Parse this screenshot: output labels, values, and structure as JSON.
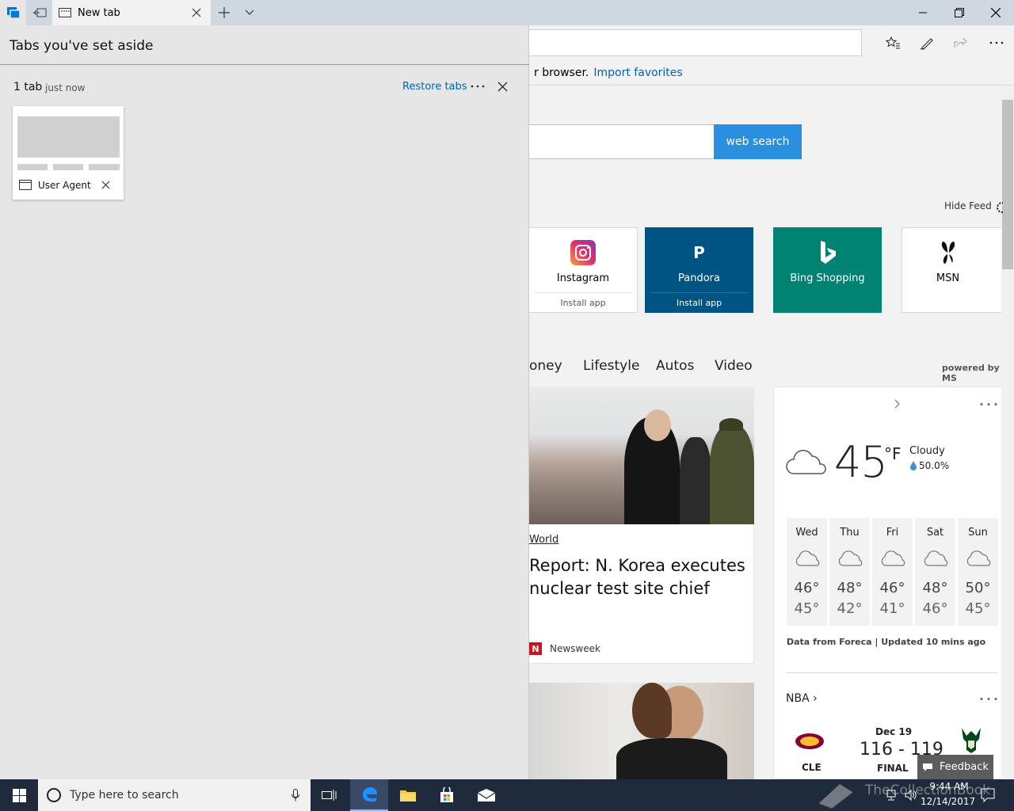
{
  "tab": {
    "title": "New tab"
  },
  "infobar": {
    "text": "r browser.",
    "link": "Import favorites"
  },
  "search": {
    "button": "web search"
  },
  "feed": {
    "hide_label": "Hide Feed"
  },
  "tiles": [
    {
      "name": "Instagram",
      "sub": "Install app"
    },
    {
      "name": "Pandora",
      "sub": "Install app"
    },
    {
      "name": "Bing Shopping"
    },
    {
      "name": "MSN"
    }
  ],
  "nav": [
    "oney",
    "Lifestyle",
    "Autos",
    "Video"
  ],
  "powered": "powered by MS",
  "news": {
    "category": "World",
    "headline": "Report: N. Korea executes nuclear test site chief",
    "source": "Newsweek",
    "source_logo": "N"
  },
  "weather": {
    "temp": "45",
    "unit": "°F",
    "condition": "Cloudy",
    "precip": "50.0%",
    "days": [
      {
        "name": "Wed",
        "hi": "46°",
        "lo": "45°"
      },
      {
        "name": "Thu",
        "hi": "48°",
        "lo": "42°"
      },
      {
        "name": "Fri",
        "hi": "46°",
        "lo": "41°"
      },
      {
        "name": "Sat",
        "hi": "48°",
        "lo": "46°"
      },
      {
        "name": "Sun",
        "hi": "50°",
        "lo": "45°"
      }
    ],
    "data_source": "Data from Foreca | Updated 10 mins ago"
  },
  "sports": {
    "league": "NBA",
    "date": "Dec 19",
    "score": "116 - 119",
    "status": "FINAL",
    "team_left": "CLE"
  },
  "feedback": "Feedback",
  "aside": {
    "title": "Tabs you've set aside",
    "count": "1 tab",
    "time": "just now",
    "restore": "Restore tabs",
    "tab_title": "User Agent"
  },
  "taskbar": {
    "search_placeholder": "Type here to search",
    "time": "9:44 AM",
    "date": "12/14/2017",
    "watermark": "TheCollectionBook"
  },
  "colors": {
    "accent": "#2b8fe0",
    "link": "#0063b1",
    "pandora": "#005483",
    "bing": "#008373",
    "taskbar": "#1f2a3d"
  }
}
